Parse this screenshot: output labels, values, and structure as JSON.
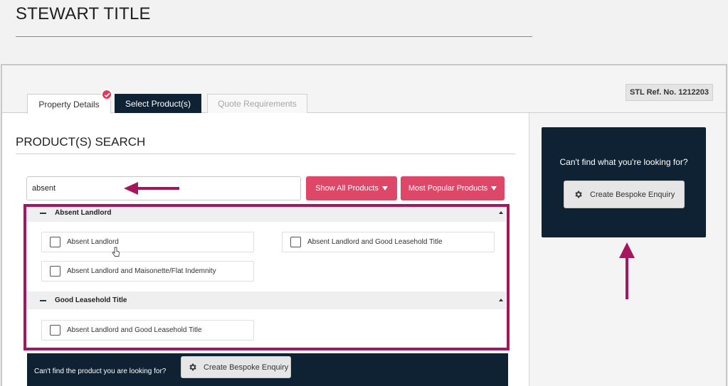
{
  "app": {
    "title": "STEWART TITLE"
  },
  "tabs": [
    {
      "label": "Property Details"
    },
    {
      "label": "Select Product(s)"
    },
    {
      "label": "Quote Requirements"
    }
  ],
  "ref_badge": "STL Ref. No. 1212203",
  "section_title": "PRODUCT(S) SEARCH",
  "search": {
    "value": "absent"
  },
  "buttons": {
    "show_all": "Show All Products",
    "most_popular": "Most Popular Products"
  },
  "groups": [
    {
      "title": "Absent Landlord",
      "items": [
        "Absent Landlord",
        "Absent Landlord and Good Leasehold Title",
        "Absent Landlord and Maisonette/Flat Indemnity"
      ]
    },
    {
      "title": "Good Leasehold Title",
      "items": [
        "Absent Landlord and Good Leasehold Title"
      ]
    }
  ],
  "bottom_bar": {
    "text": "Can't find the product you are looking for?",
    "button": "Create Bespoke Enquiry"
  },
  "side_card": {
    "text": "Can't find what you're looking for?",
    "button": "Create Bespoke Enquiry"
  },
  "colors": {
    "navy": "#0f2233",
    "accent": "#de4767",
    "annotation": "#a5165e"
  },
  "icons": [
    "check-icon",
    "caret-down-icon",
    "minus-icon",
    "collapse-arrow-icon",
    "gear-icon",
    "pointer-cursor-icon",
    "annotation-arrow-icon"
  ]
}
